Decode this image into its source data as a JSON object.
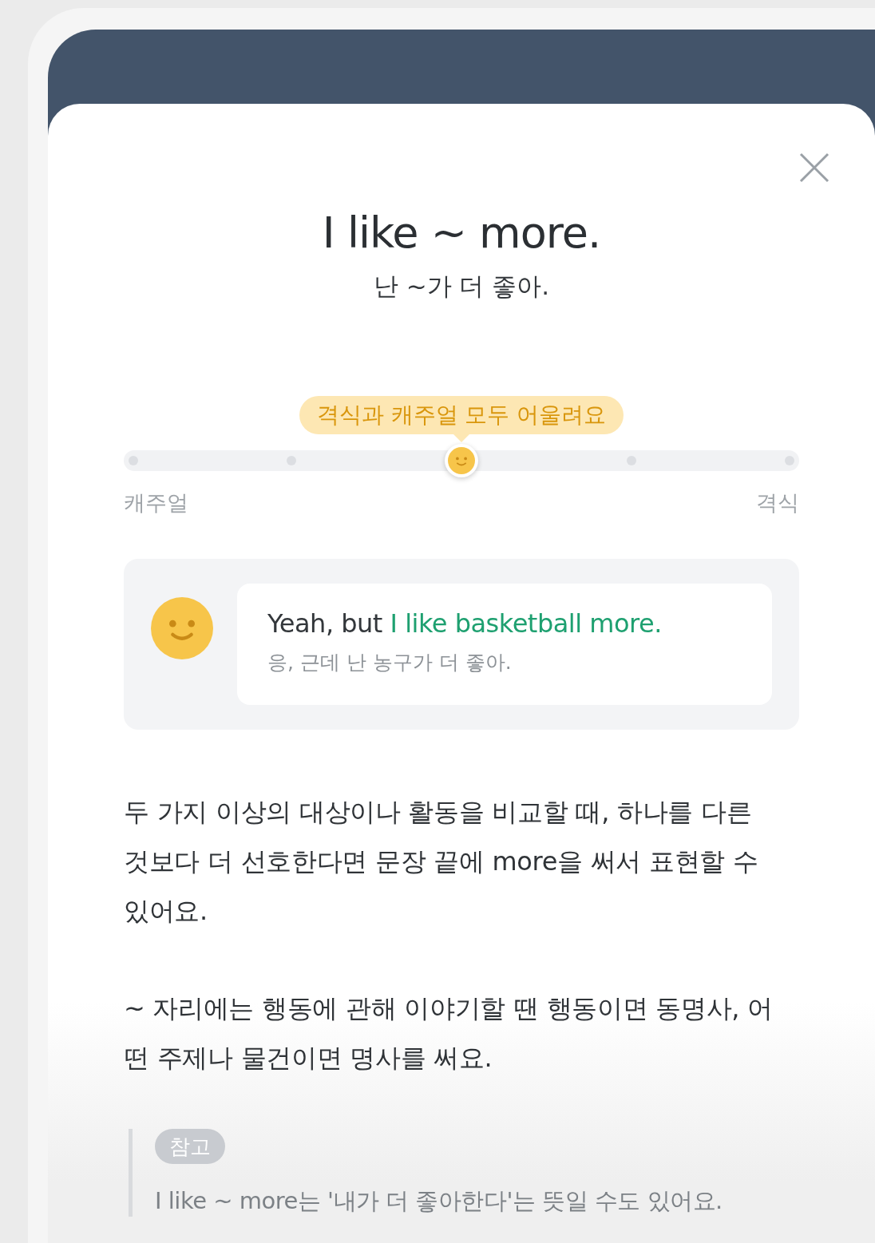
{
  "title": "I like ~ more.",
  "subtitle": "난 ~가 더 좋아.",
  "formality": {
    "tooltip": "격식과 캐주얼 모두 어울려요",
    "min_label": "캐주얼",
    "max_label": "격식",
    "stops": [
      {
        "selected": false
      },
      {
        "selected": false
      },
      {
        "selected": true
      },
      {
        "selected": false
      },
      {
        "selected": false
      }
    ]
  },
  "example": {
    "prefix": "Yeah, but ",
    "highlight": "I like basketball more.",
    "translation": "응, 근데 난 농구가 더 좋아."
  },
  "paragraphs": [
    "두 가지 이상의 대상이나 활동을 비교할 때, 하나를 다른 것보다 더 선호한다면 문장 끝에 more을 써서 표현할 수 있어요.",
    "~ 자리에는 행동에 관해 이야기할 땐 행동이면 동명사, 어떤 주제나 물건이면 명사를 써요."
  ],
  "note": {
    "badge": "참고",
    "text": "I like ~ more는 '내가 더 좋아한다'는 뜻일 수도 있어요."
  }
}
